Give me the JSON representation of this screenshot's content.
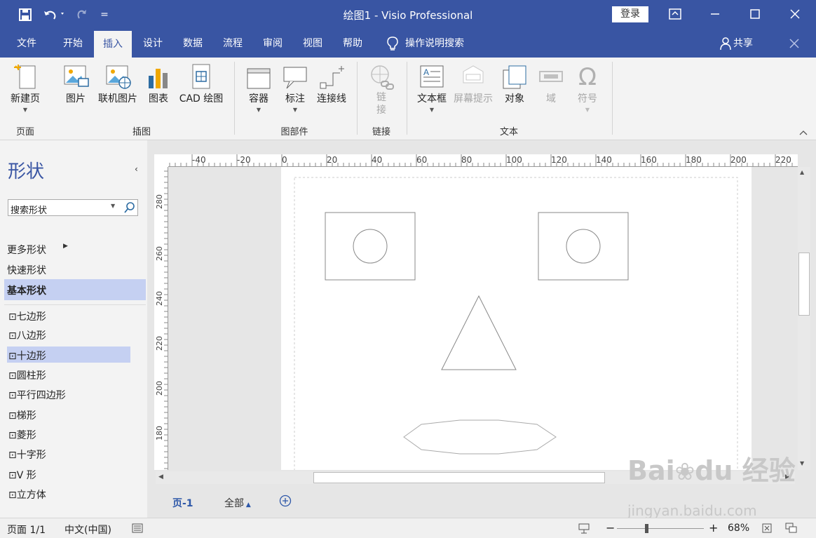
{
  "window": {
    "title": "绘图1 - Visio Professional",
    "login": "登录",
    "qat_more": "="
  },
  "tabs": [
    {
      "label": "文件"
    },
    {
      "label": "开始"
    },
    {
      "label": "插入",
      "active": true
    },
    {
      "label": "设计"
    },
    {
      "label": "数据"
    },
    {
      "label": "流程"
    },
    {
      "label": "审阅"
    },
    {
      "label": "视图"
    },
    {
      "label": "帮助"
    }
  ],
  "tell_me": "操作说明搜索",
  "share": "共享",
  "ribbon": {
    "new_page": "新建页",
    "picture": "图片",
    "online_picture": "联机图片",
    "chart": "图表",
    "cad": "CAD 绘图",
    "container": "容器",
    "callout": "标注",
    "connector": "连接线",
    "link": "链接",
    "textbox": "文本框",
    "screentip": "屏幕提示",
    "object": "对象",
    "field": "域",
    "symbol": "符号",
    "groups": {
      "page": "页面",
      "illustrations": "插图",
      "diagram_parts": "图部件",
      "links": "链接",
      "text": "文本"
    }
  },
  "shapes_pane": {
    "title": "形状",
    "search_placeholder": "搜索形状",
    "more_shapes": "更多形状",
    "quick_shapes": "快速形状",
    "basic_shapes": "基本形状",
    "items": [
      "七边形",
      "八边形",
      "十边形",
      "圆柱形",
      "平行四边形",
      "梯形",
      "菱形",
      "十字形",
      "V 形",
      "立方体"
    ]
  },
  "ruler_h": [
    "-40",
    "-20",
    "0",
    "20",
    "40",
    "60",
    "80",
    "100",
    "120",
    "140",
    "160",
    "180",
    "200",
    "220"
  ],
  "ruler_v": [
    "280",
    "260",
    "240",
    "220",
    "200",
    "180"
  ],
  "page_tabs": {
    "page1": "页-1",
    "all": "全部"
  },
  "status": {
    "page": "页面 1/1",
    "language": "中文(中国)",
    "zoom": "68%"
  },
  "watermark": {
    "logo": "Bai du 经验",
    "url": "jingyan.baidu.com"
  }
}
